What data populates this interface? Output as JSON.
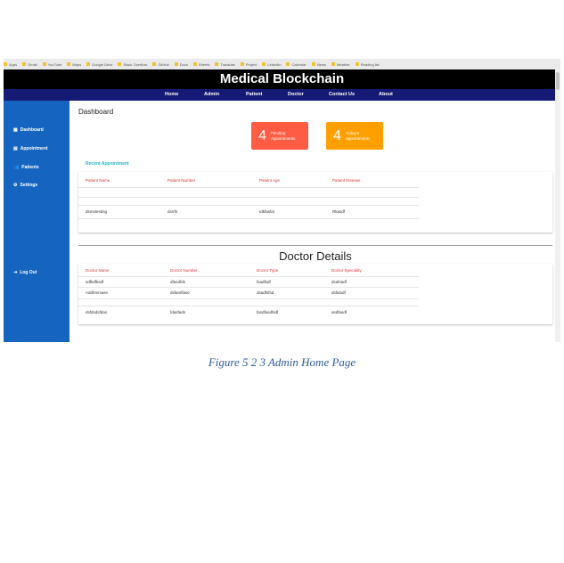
{
  "bookmarks": [
    "Apps",
    "Gmail",
    "YouTube",
    "Maps",
    "Google Drive",
    "Stack Overflow",
    "GitHub",
    "Docs",
    "Sheets",
    "Translate",
    "Project",
    "LinkedIn",
    "Calendar",
    "News",
    "Weather",
    "Reading list"
  ],
  "header": {
    "title": "Medical Blockchain"
  },
  "nav": {
    "items": [
      "Home",
      "Admin",
      "Patient",
      "Doctor",
      "Contact Us",
      "About"
    ]
  },
  "sidebar": {
    "items": [
      {
        "icon": "▦",
        "label": "Dashboard"
      },
      {
        "icon": "▤",
        "label": "Appointment"
      },
      {
        "icon": "👥",
        "label": "Patients"
      },
      {
        "icon": "⚙",
        "label": "Settings"
      }
    ],
    "logout": {
      "icon": "⇥",
      "label": "Log Out"
    }
  },
  "main": {
    "title": "Dashboard",
    "cards": [
      {
        "count": "4",
        "label1": "Pending",
        "label2": "Appointments",
        "color": "#ff5c44"
      },
      {
        "count": "4",
        "label1": "Today's",
        "label2": "Appointments",
        "color": "#ffa000"
      }
    ],
    "recent_label": "Recent Appointment",
    "appointments": {
      "headers": [
        "Patient Name",
        "Patient Number",
        "Patient Age",
        "Patient Disease"
      ],
      "rows": [
        [
          "",
          "",
          "",
          ""
        ],
        [
          "",
          "",
          "",
          ""
        ],
        [
          "dsmstesting",
          "dsrrfs",
          "Idkfasfal",
          "Rkasdf"
        ]
      ]
    },
    "doctor_section_title": "Doctor Details",
    "doctors": {
      "headers": [
        "Doctor Name",
        "Doctor Number",
        "Doctor Type",
        "Doctor Speciality"
      ],
      "rows": [
        [
          "sdfkdfksdf",
          "dfasdfds",
          "fsadfsdf",
          "dsafsadf"
        ],
        [
          "Addhmmaev",
          "dsfamflase",
          "dsadfsfsd",
          "dsfatsdf"
        ],
        [
          "",
          "",
          "",
          ""
        ],
        [
          "dsfdsdsfdas",
          "fdasfads",
          "fasdfasdfsdf",
          "asdfasdf"
        ]
      ]
    }
  },
  "caption": "Figure 5 2 3 Admin Home Page"
}
